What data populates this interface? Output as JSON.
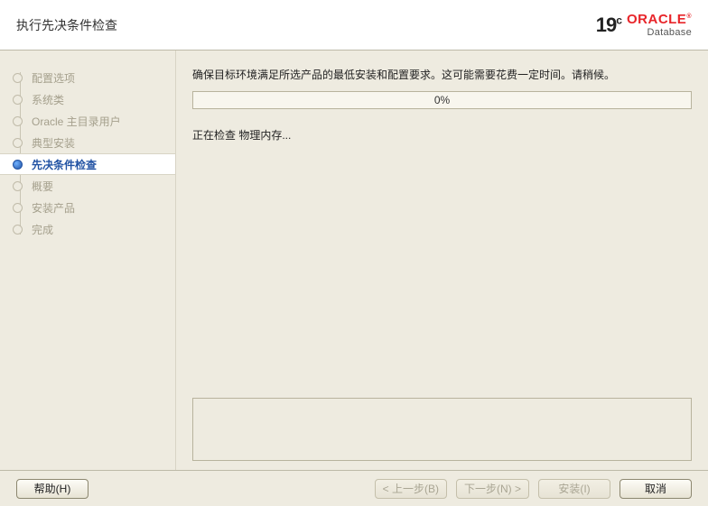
{
  "header": {
    "title": "执行先决条件检查",
    "brand_version": "19",
    "brand_version_sup": "c",
    "brand_name": "ORACLE",
    "brand_reg": "®",
    "brand_product": "Database"
  },
  "sidebar": {
    "steps": [
      {
        "label": "配置选项",
        "active": false
      },
      {
        "label": "系统类",
        "active": false
      },
      {
        "label": "Oracle 主目录用户",
        "active": false
      },
      {
        "label": "典型安装",
        "active": false
      },
      {
        "label": "先决条件检查",
        "active": true
      },
      {
        "label": "概要",
        "active": false
      },
      {
        "label": "安装产品",
        "active": false
      },
      {
        "label": "完成",
        "active": false
      }
    ]
  },
  "main": {
    "status_text": "确保目标环境满足所选产品的最低安装和配置要求。这可能需要花费一定时间。请稍候。",
    "progress_percent": "0%",
    "check_text": "正在检查 物理内存..."
  },
  "footer": {
    "help": "帮助(H)",
    "back": "< 上一步(B)",
    "next": "下一步(N) >",
    "install": "安装(I)",
    "cancel": "取消"
  }
}
